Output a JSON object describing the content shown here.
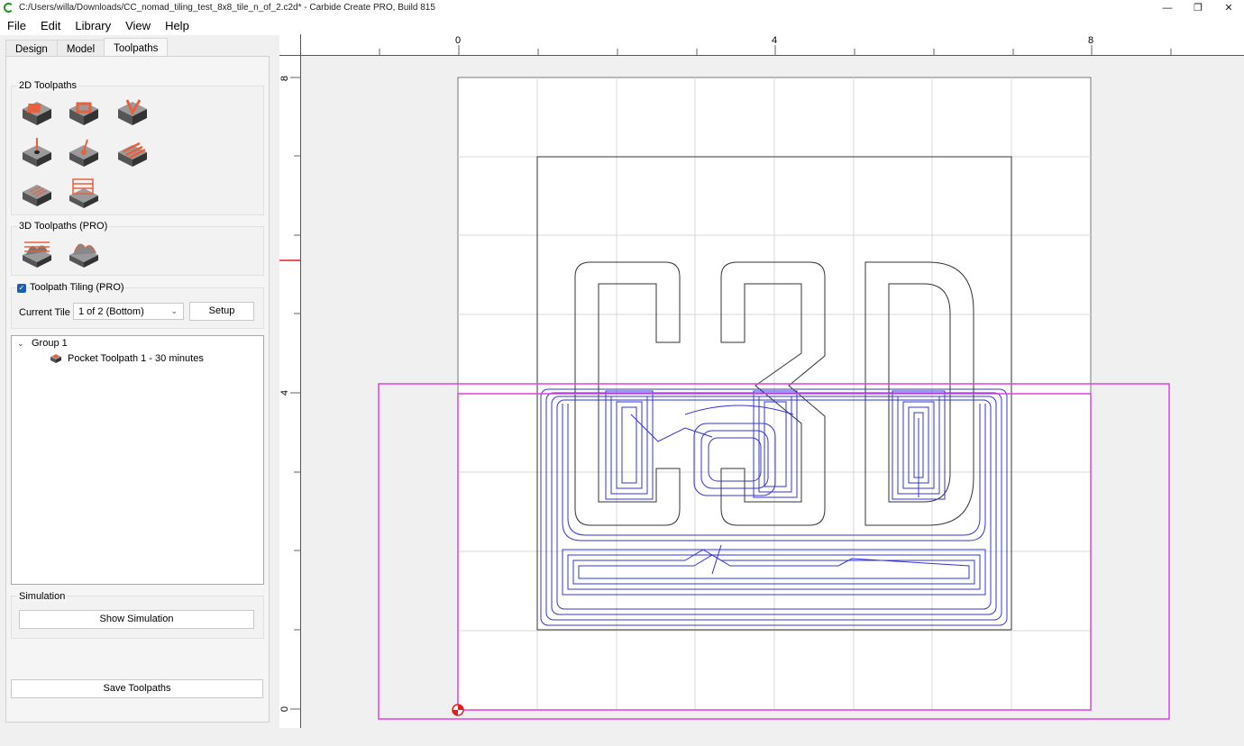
{
  "window": {
    "title": "C:/Users/willa/Downloads/CC_nomad_tiling_test_8x8_tile_n_of_2.c2d* - Carbide Create PRO, Build 815",
    "minimize": "—",
    "maximize": "❐",
    "close": "✕"
  },
  "menu": [
    "File",
    "Edit",
    "Library",
    "View",
    "Help"
  ],
  "tabs": [
    "Design",
    "Model",
    "Toolpaths"
  ],
  "active_tab": "Toolpaths",
  "sections": {
    "toolpaths_2d": "2D Toolpaths",
    "toolpaths_3d": "3D Toolpaths (PRO)",
    "tiling": "Toolpath Tiling (PRO)",
    "simulation": "Simulation"
  },
  "icons_2d": [
    "contour-toolpath-icon",
    "pocket-toolpath-icon",
    "vcarve-toolpath-icon",
    "drill-toolpath-icon",
    "advanced-vcarve-icon",
    "texture-toolpath-icon",
    "surfacing-toolpath-icon",
    "flatten-toolpath-icon"
  ],
  "icons_3d": [
    "rough-3d-icon",
    "finish-3d-icon"
  ],
  "tiling": {
    "checked": true,
    "current_tile_label": "Current Tile",
    "current_tile_value": "1 of 2 (Bottom)",
    "setup_label": "Setup"
  },
  "tree": {
    "group": "Group 1",
    "items": [
      "Pocket Toolpath 1 - 30 minutes"
    ]
  },
  "buttons": {
    "show_simulation": "Show Simulation",
    "save_toolpaths": "Save Toolpaths"
  },
  "rulers": {
    "h_labels": [
      "0",
      "4",
      "8"
    ],
    "v_labels": [
      "8",
      "4",
      "0"
    ]
  },
  "colors": {
    "toolpath": "#3535d6",
    "tile_outline": "#e040e0",
    "origin": "#e02020",
    "accent": "#e8603c"
  }
}
